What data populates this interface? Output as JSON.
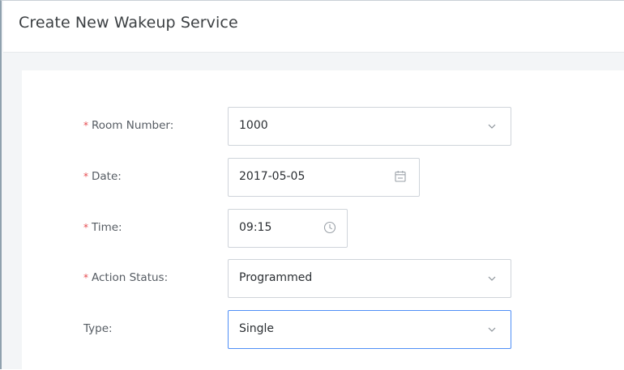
{
  "dialog": {
    "title": "Create New Wakeup Service"
  },
  "form": {
    "room_number": {
      "label": "Room Number:",
      "value": "1000",
      "required": true,
      "icon": "chevron-down-icon"
    },
    "date": {
      "label": "Date:",
      "value": "2017-05-05",
      "required": true,
      "icon": "calendar-icon"
    },
    "time": {
      "label": "Time:",
      "value": "09:15",
      "required": true,
      "icon": "clock-icon"
    },
    "action_status": {
      "label": "Action Status:",
      "value": "Programmed",
      "required": true,
      "icon": "chevron-down-icon"
    },
    "type": {
      "label": "Type:",
      "value": "Single",
      "required": false,
      "icon": "chevron-down-icon"
    }
  },
  "colors": {
    "required_star": "#e5484d",
    "focus_border": "#4f8ff7",
    "panel_background": "#f3f5f7"
  }
}
